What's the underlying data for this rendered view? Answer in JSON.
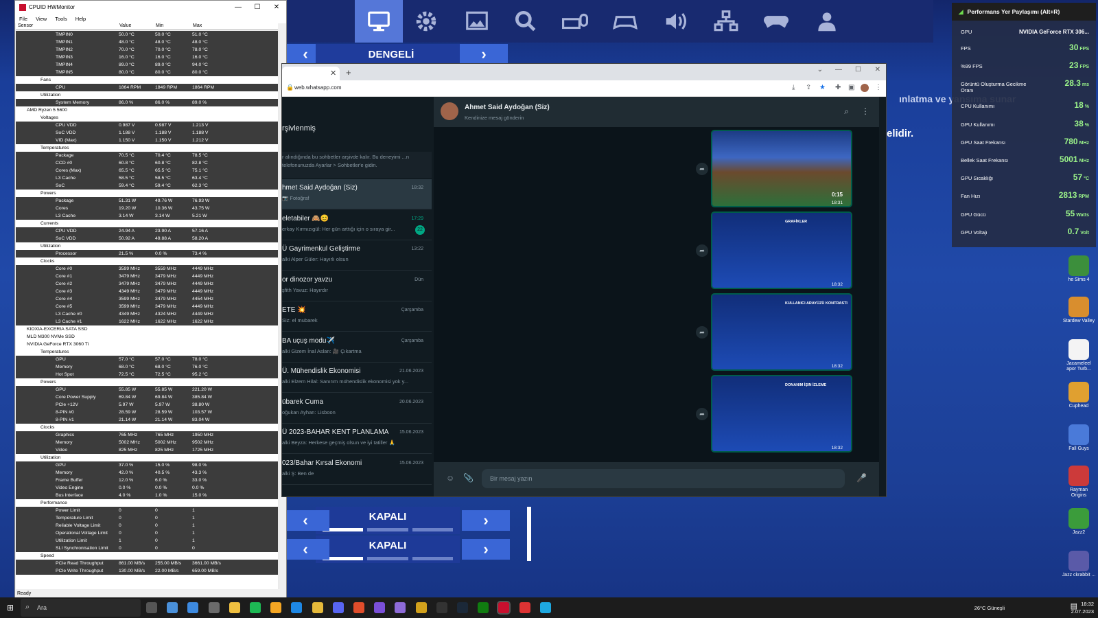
{
  "topbar": {
    "icons": [
      "monitor-icon",
      "gear-icon",
      "display-settings-icon",
      "gear-wrench-icon",
      "keyboard-mouse-icon",
      "controller-icon",
      "speaker-icon",
      "network-icon",
      "gamepad-icon",
      "account-icon"
    ]
  },
  "game_menu": {
    "mode_label": "DENGELİ",
    "headline1": "...",
    "subtitle1": "ınlatma ve yansıma sunar",
    "subtitle2": "elidir.",
    "off_label_1": "KAPALI",
    "off_label_2": "KAPALI"
  },
  "perf_overlay": {
    "header": "Performans Yer Paylaşımı (Alt+R)",
    "rows": [
      {
        "label": "GPU",
        "value": "NVIDIA GeForce RTX 306..."
      },
      {
        "label": "FPS",
        "value": "30",
        "unit": "FPS"
      },
      {
        "label": "%99 FPS",
        "value": "23",
        "unit": "FPS"
      },
      {
        "label": "Görüntü Oluşturma Gecikme Oranı",
        "value": "28.3",
        "unit": "ms"
      },
      {
        "label": "CPU Kullanımı",
        "value": "18",
        "unit": "%"
      },
      {
        "label": "GPU Kullanımı",
        "value": "38",
        "unit": "%"
      },
      {
        "label": "GPU Saat Frekansı",
        "value": "780",
        "unit": "MHz"
      },
      {
        "label": "Bellek Saat Frekansı",
        "value": "5001",
        "unit": "MHz"
      },
      {
        "label": "GPU Sıcaklığı",
        "value": "57",
        "unit": "°C"
      },
      {
        "label": "Fan Hızı",
        "value": "2813",
        "unit": "RPM"
      },
      {
        "label": "GPU Gücü",
        "value": "55",
        "unit": "Watts"
      },
      {
        "label": "GPU Voltajı",
        "value": "0.7",
        "unit": "Volt"
      }
    ]
  },
  "desktop_icons": [
    "he Sims 4",
    "Stardew Valley",
    "Jacameleel apor Turb...",
    "Cuphead",
    "Fall Guys",
    "Rayman Origins",
    "Jazz2",
    "Jazz ckrabbit ..."
  ],
  "hwmonitor": {
    "title": "CPUID HWMonitor",
    "menu": [
      "File",
      "View",
      "Tools",
      "Help"
    ],
    "columns": [
      "Sensor",
      "Value",
      "Min",
      "Max"
    ],
    "status": "Ready",
    "rows": [
      {
        "lvl": 4,
        "n": "TMPIN0",
        "v": "50.0 °C",
        "mi": "50.0 °C",
        "ma": "51.0 °C",
        "s": true
      },
      {
        "lvl": 4,
        "n": "TMPIN1",
        "v": "48.0 °C",
        "mi": "48.0 °C",
        "ma": "48.0 °C",
        "s": true
      },
      {
        "lvl": 4,
        "n": "TMPIN2",
        "v": "70.0 °C",
        "mi": "70.0 °C",
        "ma": "78.0 °C",
        "s": true
      },
      {
        "lvl": 4,
        "n": "TMPIN3",
        "v": "16.0 °C",
        "mi": "16.0 °C",
        "ma": "16.0 °C",
        "s": true
      },
      {
        "lvl": 4,
        "n": "TMPIN4",
        "v": "89.0 °C",
        "mi": "89.0 °C",
        "ma": "94.0 °C",
        "s": true
      },
      {
        "lvl": 4,
        "n": "TMPIN5",
        "v": "80.0 °C",
        "mi": "80.0 °C",
        "ma": "80.0 °C",
        "s": true
      },
      {
        "lvl": 3,
        "n": "Fans",
        "v": "",
        "mi": "",
        "ma": "",
        "s": false
      },
      {
        "lvl": 4,
        "n": "CPU",
        "v": "1864 RPM",
        "mi": "1849 RPM",
        "ma": "1864 RPM",
        "s": true
      },
      {
        "lvl": 3,
        "n": "Utilization",
        "v": "",
        "mi": "",
        "ma": "",
        "s": false
      },
      {
        "lvl": 4,
        "n": "System Memory",
        "v": "86.0 %",
        "mi": "86.0 %",
        "ma": "89.0 %",
        "s": true
      },
      {
        "lvl": 2,
        "n": "AMD Ryzen 5 5600",
        "v": "",
        "mi": "",
        "ma": "",
        "s": false
      },
      {
        "lvl": 3,
        "n": "Voltages",
        "v": "",
        "mi": "",
        "ma": "",
        "s": false
      },
      {
        "lvl": 4,
        "n": "CPU VDD",
        "v": "0.987 V",
        "mi": "0.987 V",
        "ma": "1.213 V",
        "s": true
      },
      {
        "lvl": 4,
        "n": "SoC VDD",
        "v": "1.188 V",
        "mi": "1.188 V",
        "ma": "1.188 V",
        "s": true
      },
      {
        "lvl": 4,
        "n": "VID (Max)",
        "v": "1.150 V",
        "mi": "1.150 V",
        "ma": "1.212 V",
        "s": true
      },
      {
        "lvl": 3,
        "n": "Temperatures",
        "v": "",
        "mi": "",
        "ma": "",
        "s": false
      },
      {
        "lvl": 4,
        "n": "Package",
        "v": "70.5 °C",
        "mi": "70.4 °C",
        "ma": "78.5 °C",
        "s": true
      },
      {
        "lvl": 4,
        "n": "CCD #0",
        "v": "60.8 °C",
        "mi": "60.8 °C",
        "ma": "82.8 °C",
        "s": true
      },
      {
        "lvl": 4,
        "n": "Cores (Max)",
        "v": "65.5 °C",
        "mi": "65.5 °C",
        "ma": "75.1 °C",
        "s": true
      },
      {
        "lvl": 4,
        "n": "L3 Cache",
        "v": "58.5 °C",
        "mi": "58.5 °C",
        "ma": "63.4 °C",
        "s": true
      },
      {
        "lvl": 4,
        "n": "SoC",
        "v": "59.4 °C",
        "mi": "59.4 °C",
        "ma": "62.3 °C",
        "s": true
      },
      {
        "lvl": 3,
        "n": "Powers",
        "v": "",
        "mi": "",
        "ma": "",
        "s": false
      },
      {
        "lvl": 4,
        "n": "Package",
        "v": "51.31 W",
        "mi": "49.76 W",
        "ma": "76.93 W",
        "s": true
      },
      {
        "lvl": 4,
        "n": "Cores",
        "v": "19.20 W",
        "mi": "10.36 W",
        "ma": "43.75 W",
        "s": true
      },
      {
        "lvl": 4,
        "n": "L3 Cache",
        "v": "3.14 W",
        "mi": "3.14 W",
        "ma": "5.21 W",
        "s": true
      },
      {
        "lvl": 3,
        "n": "Currents",
        "v": "",
        "mi": "",
        "ma": "",
        "s": false
      },
      {
        "lvl": 4,
        "n": "CPU VDD",
        "v": "24.94 A",
        "mi": "23.90 A",
        "ma": "57.16 A",
        "s": true
      },
      {
        "lvl": 4,
        "n": "SoC VDD",
        "v": "50.92 A",
        "mi": "49.88 A",
        "ma": "58.20 A",
        "s": true
      },
      {
        "lvl": 3,
        "n": "Utilization",
        "v": "",
        "mi": "",
        "ma": "",
        "s": false
      },
      {
        "lvl": 4,
        "n": "Processor",
        "v": "21.5 %",
        "mi": "0.0 %",
        "ma": "73.4 %",
        "s": true
      },
      {
        "lvl": 3,
        "n": "Clocks",
        "v": "",
        "mi": "",
        "ma": "",
        "s": false
      },
      {
        "lvl": 4,
        "n": "Core #0",
        "v": "3599 MHz",
        "mi": "3559 MHz",
        "ma": "4449 MHz",
        "s": true
      },
      {
        "lvl": 4,
        "n": "Core #1",
        "v": "3479 MHz",
        "mi": "3479 MHz",
        "ma": "4449 MHz",
        "s": true
      },
      {
        "lvl": 4,
        "n": "Core #2",
        "v": "3479 MHz",
        "mi": "3479 MHz",
        "ma": "4449 MHz",
        "s": true
      },
      {
        "lvl": 4,
        "n": "Core #3",
        "v": "4349 MHz",
        "mi": "3479 MHz",
        "ma": "4449 MHz",
        "s": true
      },
      {
        "lvl": 4,
        "n": "Core #4",
        "v": "3599 MHz",
        "mi": "3479 MHz",
        "ma": "4454 MHz",
        "s": true
      },
      {
        "lvl": 4,
        "n": "Core #5",
        "v": "3599 MHz",
        "mi": "3479 MHz",
        "ma": "4449 MHz",
        "s": true
      },
      {
        "lvl": 4,
        "n": "L3 Cache #0",
        "v": "4349 MHz",
        "mi": "4324 MHz",
        "ma": "4449 MHz",
        "s": true
      },
      {
        "lvl": 4,
        "n": "L3 Cache #1",
        "v": "1622 MHz",
        "mi": "1622 MHz",
        "ma": "1622 MHz",
        "s": true
      },
      {
        "lvl": 1,
        "n": "KIOXIA-EXCERIA SATA SSD",
        "v": "",
        "mi": "",
        "ma": "",
        "s": false
      },
      {
        "lvl": 1,
        "n": "MLD M300 NVMe SSD",
        "v": "",
        "mi": "",
        "ma": "",
        "s": false
      },
      {
        "lvl": 1,
        "n": "NVIDIA GeForce RTX 3060 Ti",
        "v": "",
        "mi": "",
        "ma": "",
        "s": false
      },
      {
        "lvl": 3,
        "n": "Temperatures",
        "v": "",
        "mi": "",
        "ma": "",
        "s": false
      },
      {
        "lvl": 4,
        "n": "GPU",
        "v": "57.0 °C",
        "mi": "57.0 °C",
        "ma": "78.0 °C",
        "s": true
      },
      {
        "lvl": 4,
        "n": "Memory",
        "v": "68.0 °C",
        "mi": "68.0 °C",
        "ma": "76.0 °C",
        "s": true
      },
      {
        "lvl": 4,
        "n": "Hot Spot",
        "v": "72.5 °C",
        "mi": "72.5 °C",
        "ma": "95.2 °C",
        "s": true
      },
      {
        "lvl": 3,
        "n": "Powers",
        "v": "",
        "mi": "",
        "ma": "",
        "s": false
      },
      {
        "lvl": 4,
        "n": "GPU",
        "v": "55.85 W",
        "mi": "55.85 W",
        "ma": "221.20 W",
        "s": true
      },
      {
        "lvl": 4,
        "n": "Core Power Supply",
        "v": "69.84 W",
        "mi": "69.84 W",
        "ma": "385.84 W",
        "s": true
      },
      {
        "lvl": 4,
        "n": "PCIe +12V",
        "v": "5.97 W",
        "mi": "5.97 W",
        "ma": "38.80 W",
        "s": true
      },
      {
        "lvl": 4,
        "n": "8-PIN #0",
        "v": "28.59 W",
        "mi": "28.59 W",
        "ma": "103.57 W",
        "s": true
      },
      {
        "lvl": 4,
        "n": "8-PIN #1",
        "v": "21.14 W",
        "mi": "21.14 W",
        "ma": "83.04 W",
        "s": true
      },
      {
        "lvl": 3,
        "n": "Clocks",
        "v": "",
        "mi": "",
        "ma": "",
        "s": false
      },
      {
        "lvl": 4,
        "n": "Graphics",
        "v": "765 MHz",
        "mi": "765 MHz",
        "ma": "1950 MHz",
        "s": true
      },
      {
        "lvl": 4,
        "n": "Memory",
        "v": "5002 MHz",
        "mi": "5002 MHz",
        "ma": "9502 MHz",
        "s": true
      },
      {
        "lvl": 4,
        "n": "Video",
        "v": "825 MHz",
        "mi": "825 MHz",
        "ma": "1725 MHz",
        "s": true
      },
      {
        "lvl": 3,
        "n": "Utilization",
        "v": "",
        "mi": "",
        "ma": "",
        "s": false
      },
      {
        "lvl": 4,
        "n": "GPU",
        "v": "37.0 %",
        "mi": "15.0 %",
        "ma": "98.0 %",
        "s": true
      },
      {
        "lvl": 4,
        "n": "Memory",
        "v": "42.0 %",
        "mi": "40.5 %",
        "ma": "43.3 %",
        "s": true
      },
      {
        "lvl": 4,
        "n": "Frame Buffer",
        "v": "12.0 %",
        "mi": "6.0 %",
        "ma": "33.0 %",
        "s": true
      },
      {
        "lvl": 4,
        "n": "Video Engine",
        "v": "0.0 %",
        "mi": "0.0 %",
        "ma": "0.0 %",
        "s": true
      },
      {
        "lvl": 4,
        "n": "Bus Interface",
        "v": "4.0 %",
        "mi": "1.0 %",
        "ma": "15.0 %",
        "s": true
      },
      {
        "lvl": 3,
        "n": "Performance",
        "v": "",
        "mi": "",
        "ma": "",
        "s": false
      },
      {
        "lvl": 4,
        "n": "Power Limit",
        "v": "0",
        "mi": "0",
        "ma": "1",
        "s": true
      },
      {
        "lvl": 4,
        "n": "Temperature Limit",
        "v": "0",
        "mi": "0",
        "ma": "1",
        "s": true
      },
      {
        "lvl": 4,
        "n": "Reliable Voltage Limit",
        "v": "0",
        "mi": "0",
        "ma": "1",
        "s": true
      },
      {
        "lvl": 4,
        "n": "Operational Voltage Limit",
        "v": "0",
        "mi": "0",
        "ma": "1",
        "s": true
      },
      {
        "lvl": 4,
        "n": "Utilization Limit",
        "v": "1",
        "mi": "0",
        "ma": "1",
        "s": true
      },
      {
        "lvl": 4,
        "n": "SLI Synchronisation Limit",
        "v": "0",
        "mi": "0",
        "ma": "0",
        "s": true
      },
      {
        "lvl": 3,
        "n": "Speed",
        "v": "",
        "mi": "",
        "ma": "",
        "s": false
      },
      {
        "lvl": 4,
        "n": "PCIe Read Throughput",
        "v": "861.00 MB/s",
        "mi": "255.00 MB/s",
        "ma": "3661.00 MB/s",
        "s": true
      },
      {
        "lvl": 4,
        "n": "PCIe Write Throughput",
        "v": "130.00 MB/s",
        "mi": "22.00 MB/s",
        "ma": "659.00 MB/s",
        "s": true
      }
    ]
  },
  "browser": {
    "url": "web.whatsapp.com"
  },
  "whatsapp": {
    "archived_title": "rşivlenmiş",
    "archived_info": "r alındığında bu sohbetler arşivde kalır. Bu deneyimi ...n telefonunuzda Ayarlar > Sohbetler'e gidin.",
    "chats": [
      {
        "name": "hmet Said Aydoğan (Siz)",
        "msg": "📷 Fotoğraf",
        "time": "18:32"
      },
      {
        "name": "eletabiler 🙈😊",
        "msg": "erkay Kırmızıgül: Her gün arttığı için o sıraya gir...",
        "time": "17:29",
        "badge": "22"
      },
      {
        "name": "Ü Gayrimenkul Geliştirme",
        "msg": "alki Alper Güler: Hayırlı olsun",
        "time": "13:22"
      },
      {
        "name": "or dinozor yavzu",
        "msg": "şfith Yavuz: Hayırdır",
        "time": "Dün"
      },
      {
        "name": "ETE 💥",
        "msg": "Siz: el mubarek",
        "time": "Çarşamba"
      },
      {
        "name": "BA uçuş modu✈️",
        "msg": "alki Gizem İnal Aslan: 🎥 Çıkartma",
        "time": "Çarşamba"
      },
      {
        "name": "Ü. Mühendislik Ekonomisi",
        "msg": "alki Elzem Hilal: Sanırım mühendislik ekonomisi yok y...",
        "time": "21.06.2023"
      },
      {
        "name": "übarek Cuma",
        "msg": "oğukan Ayhan: Lisboon",
        "time": "20.06.2023"
      },
      {
        "name": "Ü 2023-BAHAR KENT PLANLAMA",
        "msg": "alki Beyza: Herkese geçmiş olsun ve iyi tatiller 🙏",
        "time": "15.06.2023"
      },
      {
        "name": "023/Bahar Kırsal Ekonomi",
        "msg": "alki Ş: Ben de",
        "time": "15.06.2023"
      }
    ],
    "chat_header": {
      "name": "Ahmet Said Aydoğan (Siz)",
      "status": "Kendinize mesaj gönderin"
    },
    "media": [
      {
        "time": "18:31",
        "duration": "0:15",
        "kind": "video"
      },
      {
        "time": "18:32",
        "kind": "image",
        "caption": "GRAFİKLER"
      },
      {
        "time": "18:32",
        "kind": "image",
        "caption": "KULLANICI ARAYÜZÜ KONTRASTI"
      },
      {
        "time": "18:32",
        "kind": "image",
        "caption": "DONANIM İŞIN İZLEME"
      }
    ],
    "input_placeholder": "Bir mesaj yazın"
  },
  "taskbar": {
    "search": "Ara",
    "weather": "26°C Güneşli",
    "time": "18:32",
    "date": "2.07.2023"
  }
}
